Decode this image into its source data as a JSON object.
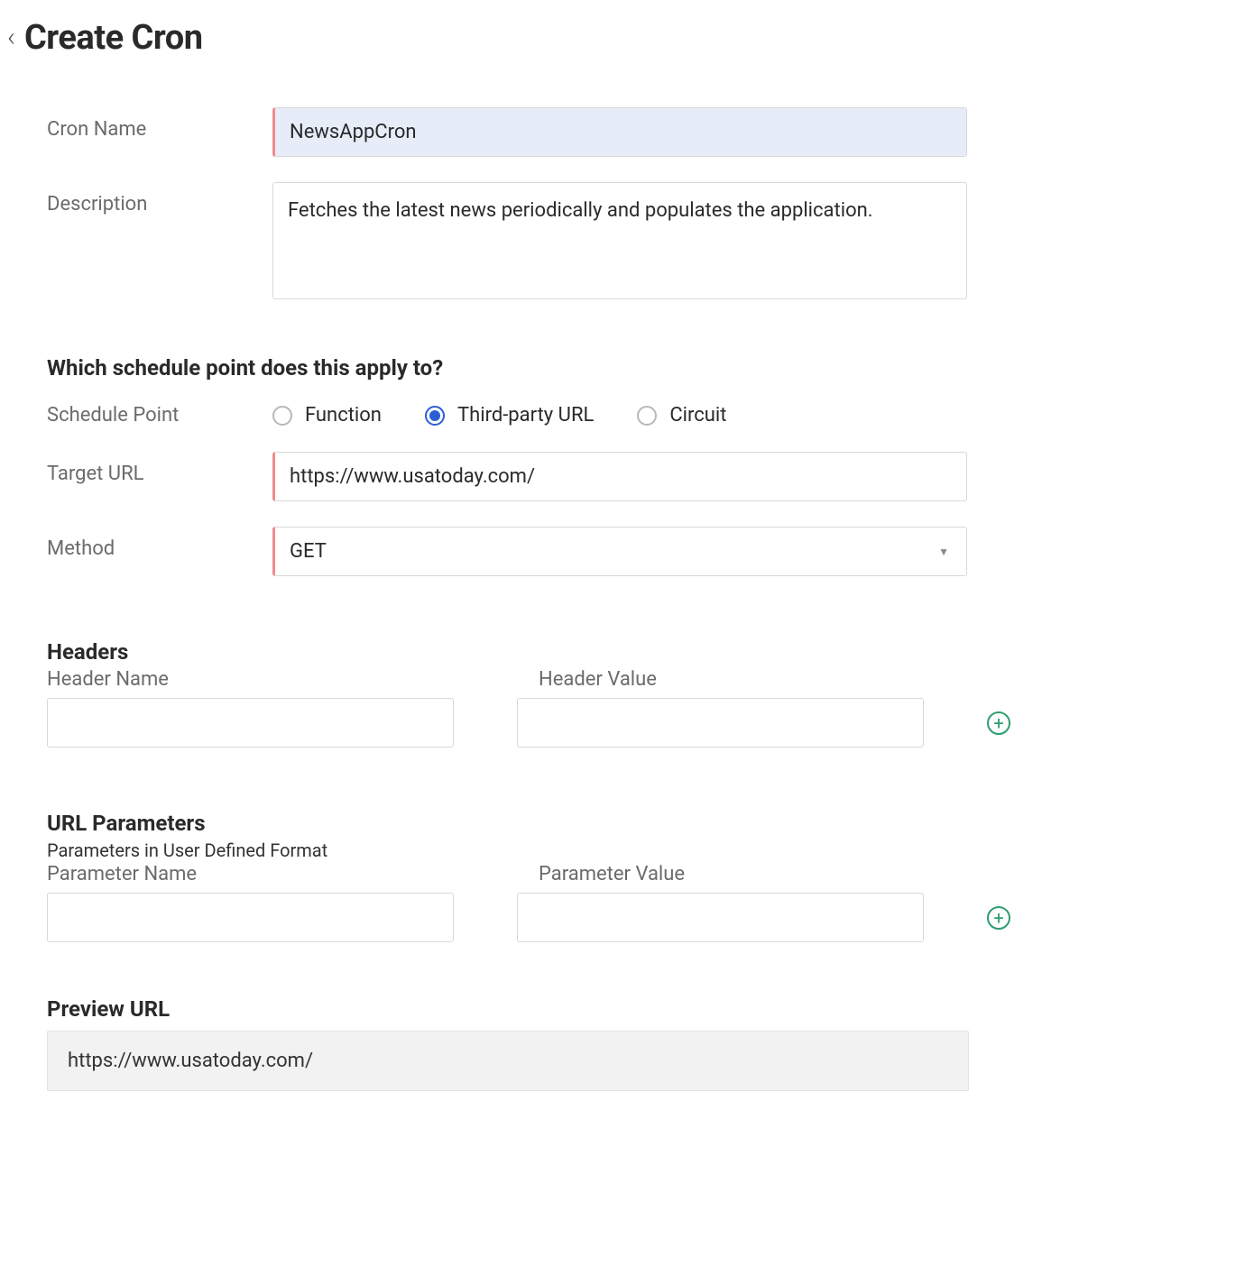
{
  "header": {
    "title": "Create Cron"
  },
  "fields": {
    "cron_name": {
      "label": "Cron Name",
      "value": "NewsAppCron"
    },
    "description": {
      "label": "Description",
      "value": "Fetches the latest news periodically and populates the application."
    }
  },
  "schedule": {
    "question": "Which schedule point does this apply to?",
    "label": "Schedule Point",
    "options": {
      "function": "Function",
      "thirdparty": "Third-party URL",
      "circuit": "Circuit"
    },
    "selected": "thirdparty"
  },
  "target": {
    "label": "Target URL",
    "value": "https://www.usatoday.com/"
  },
  "method": {
    "label": "Method",
    "value": "GET"
  },
  "headers": {
    "title": "Headers",
    "name_label": "Header Name",
    "value_label": "Header Value",
    "name_val": "",
    "value_val": ""
  },
  "params": {
    "title": "URL Parameters",
    "note": "Parameters in User Defined Format",
    "name_label": "Parameter Name",
    "value_label": "Parameter Value",
    "name_val": "",
    "value_val": ""
  },
  "preview": {
    "title": "Preview URL",
    "value": "https://www.usatoday.com/"
  }
}
